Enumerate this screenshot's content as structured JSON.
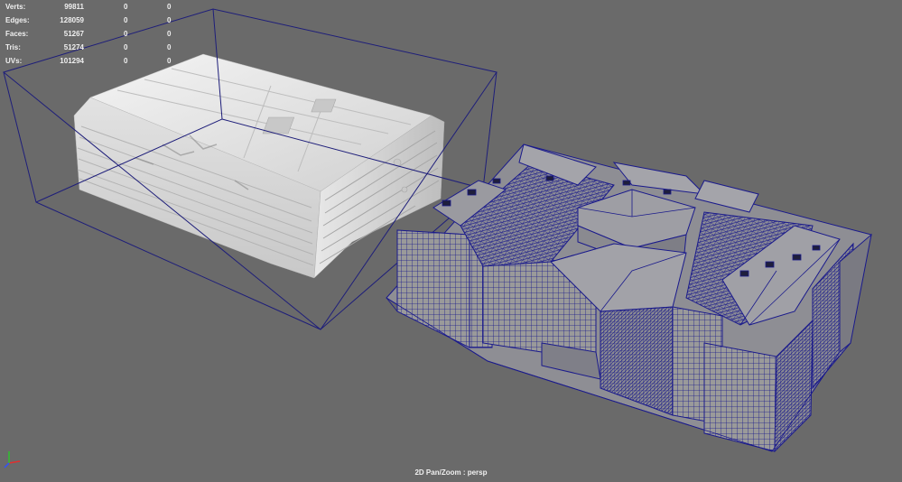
{
  "hud": {
    "rows": [
      {
        "label": "Verts:",
        "v1": "99811",
        "v2": "0",
        "v3": "0"
      },
      {
        "label": "Edges:",
        "v1": "128059",
        "v2": "0",
        "v3": "0"
      },
      {
        "label": "Faces:",
        "v1": "51267",
        "v2": "0",
        "v3": "0"
      },
      {
        "label": "Tris:",
        "v1": "51274",
        "v2": "0",
        "v3": "0"
      },
      {
        "label": "UVs:",
        "v1": "101294",
        "v2": "0",
        "v3": "0"
      }
    ]
  },
  "viewport": {
    "camera_label": "2D Pan/Zoom : persp",
    "background_color": "#6a6a6a",
    "wireframe_color": "#1a1a8c",
    "bounding_box_color": "#1e1e7a",
    "mesh_color": "#e6e6e6"
  },
  "axis_indicator": {
    "icon": "xyz-axis-icon",
    "x_color": "#e03030",
    "y_color": "#30c030",
    "z_color": "#3050ff"
  }
}
